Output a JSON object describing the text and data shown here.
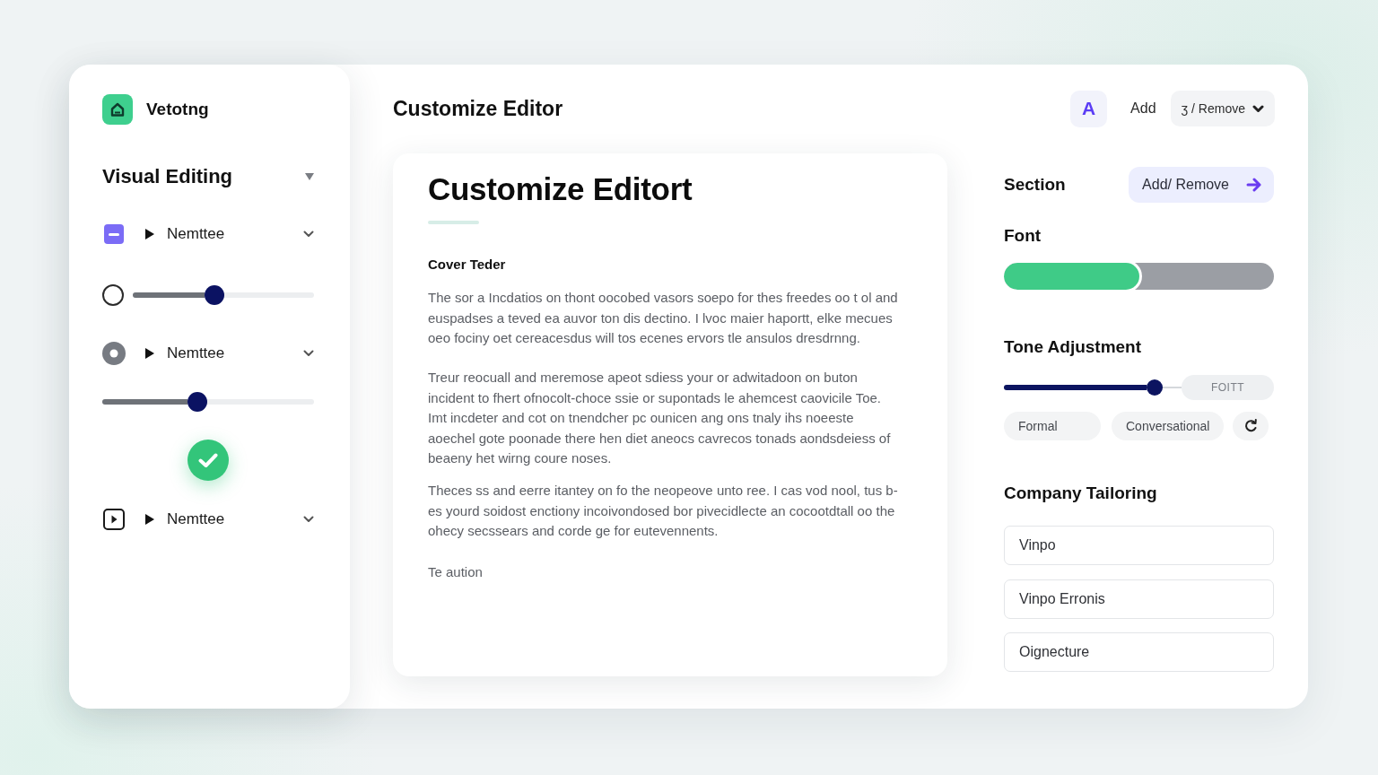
{
  "sidebar": {
    "brand": "Vetotng",
    "section": {
      "title": "Visual Editing",
      "expanded": true
    },
    "items": [
      {
        "kind": "group",
        "label": "Nemttee",
        "expanded": false
      },
      {
        "kind": "slider",
        "level": 0.45
      },
      {
        "kind": "group",
        "label": "Nemttee",
        "expanded": false
      },
      {
        "kind": "slider",
        "level": 0.45
      },
      {
        "kind": "confirm"
      },
      {
        "kind": "group",
        "label": "Nemttee",
        "expanded": false
      }
    ]
  },
  "header": {
    "title": "Customize Editor",
    "style_button": "A",
    "add_button": "Add",
    "remove_menu": "ʒ / Remove"
  },
  "document": {
    "title": "Customize Editort",
    "subtitle": "Cover Teder",
    "paragraphs": [
      "The sor a Incdatios on thont oocobed vasors soepo for thes freedes oo t ol and euspadses a teved ea auvor ton dis dectino. I lvoc maier haportt, elke mecues oeo fociny oet cereacesdus will tos ecenes ervors tle ansulos dresdrnng.",
      "Treur reocuall and meremose apeot sdiess your or adwitadoon on buton incident to fhert ofnocolt-choce ssie or supontads le ahemcest caovicile Toe. Imt incdeter and cot on tnendcher pc ounicen ang ons tnaly ihs noeeste aoechel gote poonade there hen diet aneocs cavrecos tonads aondsdeiess of beaeny het wirng coure noses.",
      "Theces ss and eerre itantey on fo the neopeove unto ree. I cas vod nool, tus b- es yourd soidost enctiony incoivondosed bor pivecidlecte an cocootdtall oo the ohecy secssears and corde ge for eutevennents."
    ],
    "closing": "Te aution"
  },
  "panel": {
    "section": {
      "label": "Section",
      "button": "Add/ Remove"
    },
    "font": {
      "label": "Font",
      "level": 0.5
    },
    "tone": {
      "label": "Tone Adjustment",
      "level": 0.85,
      "badge": "FOITT",
      "options": [
        {
          "label": "Formal",
          "selected": false
        },
        {
          "label": "Conversational",
          "selected": false
        }
      ]
    },
    "company": {
      "label": "Company Tailoring",
      "fields": [
        {
          "value": "Vinpo"
        },
        {
          "value": "Vinpo Erronis"
        },
        {
          "value": "Oignecture"
        }
      ]
    }
  }
}
